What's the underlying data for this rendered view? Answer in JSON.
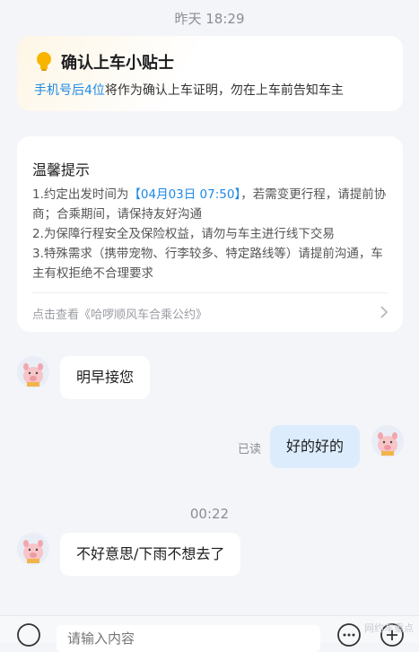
{
  "timestamps": {
    "first": "昨天 18:29",
    "second": "00:22"
  },
  "tip_card": {
    "title": "确认上车小贴士",
    "subtitle_highlight": "手机号后4位",
    "subtitle_rest": "将作为确认上车证明，勿在上车前告知车主",
    "icon": "lightbulb-icon"
  },
  "warm_card": {
    "title": "温馨提示",
    "line1_prefix": "1.约定出发时间为",
    "line1_time": "【04月03日 07:50】",
    "line1_suffix": "，若需变更行程，请提前协商；合乘期间，请保持友好沟通",
    "line2": "2.为保障行程安全及保险权益，请勿与车主进行线下交易",
    "line3": "3.特殊需求（携带宠物、行李较多、特定路线等）请提前沟通，车主有权拒绝不合理要求",
    "link": "点击查看《哈啰顺风车合乘公约》"
  },
  "messages": [
    {
      "from": "other",
      "text": "明早接您"
    },
    {
      "from": "me",
      "text": "好的好的",
      "status": "已读"
    },
    {
      "from": "other",
      "text": "不好意思/下雨不想去了"
    }
  ],
  "input": {
    "placeholder": "请输入内容"
  },
  "watermark": "网约车重点",
  "colors": {
    "accent": "#1e88e5",
    "me_bubble": "#dcecfd",
    "background": "#f4f5f9"
  }
}
